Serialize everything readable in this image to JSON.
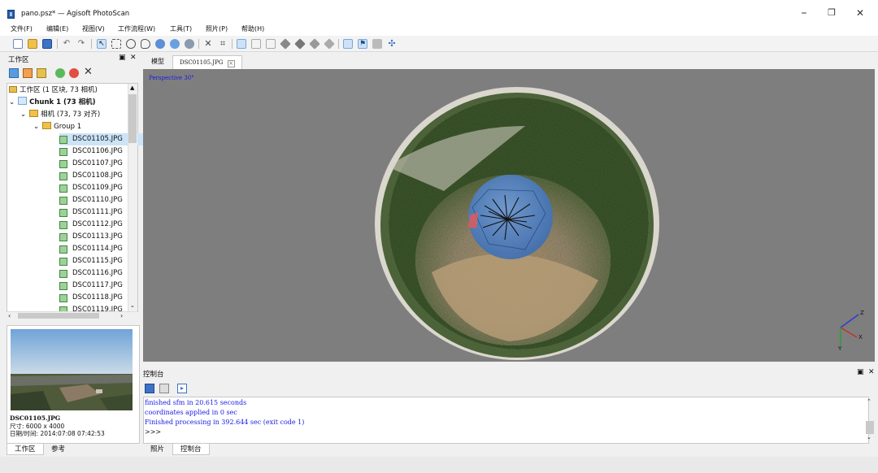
{
  "window": {
    "title": "pano.psz* — Agisoft PhotoScan",
    "controls": {
      "minimize": "–",
      "restore": "❐",
      "close": "✕"
    }
  },
  "menu": [
    "文件(F)",
    "编辑(E)",
    "视图(V)",
    "工作流程(W)",
    "工具(T)",
    "照片(P)",
    "帮助(H)"
  ],
  "toolbar": {
    "icons": [
      "new-icon",
      "open-icon",
      "save-icon",
      "undo-icon",
      "redo-icon",
      "select-icon",
      "rect-select-icon",
      "circle-select-icon",
      "free-select-icon",
      "navigation-icon",
      "rotate-icon",
      "move-icon",
      "delete-icon",
      "crop-icon",
      "grid-icon",
      "grid2-icon",
      "grid3-icon",
      "shading-icon",
      "solid-icon",
      "texture-icon",
      "points-icon",
      "show-cameras-icon",
      "show-markers-icon",
      "show-region-icon",
      "move-region-icon"
    ]
  },
  "workspace": {
    "title": "工作区",
    "float_icon": "▣",
    "close_icon": "✕",
    "tree": {
      "root": "工作区 (1 区块, 73 相机)",
      "chunk": "Chunk 1 (73 相机)",
      "cameras": "相机 (73, 73 对齐)",
      "group": "Group 1",
      "images": [
        "DSC01105.JPG",
        "DSC01106.JPG",
        "DSC01107.JPG",
        "DSC01108.JPG",
        "DSC01109.JPG",
        "DSC01110.JPG",
        "DSC01111.JPG",
        "DSC01112.JPG",
        "DSC01113.JPG",
        "DSC01114.JPG",
        "DSC01115.JPG",
        "DSC01116.JPG",
        "DSC01117.JPG",
        "DSC01118.JPG",
        "DSC01119.JPG"
      ]
    }
  },
  "photo_info": {
    "name": "DSC01105.JPG",
    "size": "尺寸: 6000 x 4000",
    "date": "日期/时间: 2014:07:08 07:42:53"
  },
  "left_tabs": [
    "工作区",
    "参考"
  ],
  "view_tabs": [
    "模型",
    "DSC01105.JPG"
  ],
  "viewport": {
    "label": "Perspective 30°",
    "axes": {
      "x": "X",
      "y": "Y",
      "z": "Z"
    }
  },
  "console": {
    "title": "控制台",
    "lines": [
      "finished sfm in 20.615 seconds",
      "coordinates applied in 0 sec",
      "Finished processing in 392.644 sec (exit code 1)",
      ">>>"
    ]
  },
  "right_tabs": [
    "照片",
    "控制台"
  ],
  "colors": {
    "background": "#7e7e7e",
    "sphere": "#4a7fc4",
    "accent": "#1a1ae6"
  }
}
